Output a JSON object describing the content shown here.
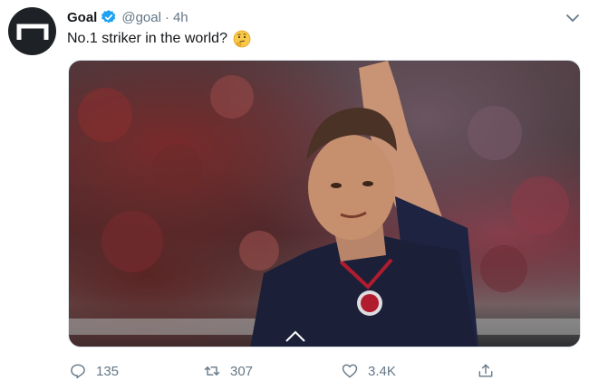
{
  "tweet": {
    "author_name": "Goal",
    "handle": "@goal",
    "separator": "·",
    "time": "4h",
    "text": "No.1 striker in the world?",
    "emoji": "thinking-face",
    "media_alt": "photo",
    "actions": {
      "replies": "135",
      "retweets": "307",
      "likes": "3.4K"
    }
  },
  "colors": {
    "accent": "#1da1f2",
    "muted": "#657786",
    "text": "#14171a",
    "avatar_bg": "#1e2125"
  }
}
